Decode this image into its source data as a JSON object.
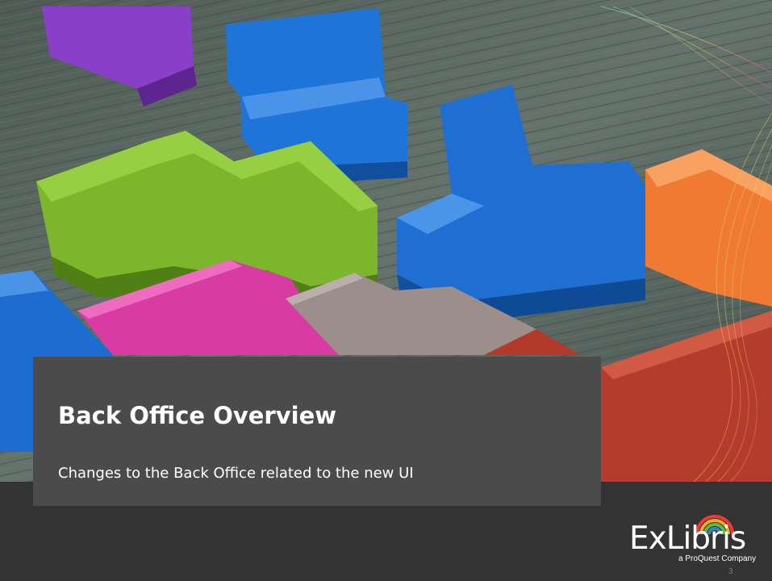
{
  "slide": {
    "title": "Back Office Overview",
    "subtitle": "Changes to the Back Office related to the new UI",
    "slide_number": "3"
  },
  "brand": {
    "logo_text": "ExLibris",
    "tagline": "a ProQuest Company"
  },
  "colors": {
    "background": "#333333",
    "title_panel": "#4b4b4b",
    "text": "#ffffff",
    "block_blue": "#1e73d6",
    "block_green": "#7fb82c",
    "block_pink": "#d63ca0",
    "block_purple": "#8a3fc9",
    "block_orange": "#f07a32",
    "block_red": "#b0392a",
    "block_gray": "#9a8c8a",
    "wood": "#5d6a63"
  },
  "icons": {
    "brand_mark": "rainbow-arc-icon",
    "hero": "wooden-puzzle-blocks-image"
  }
}
